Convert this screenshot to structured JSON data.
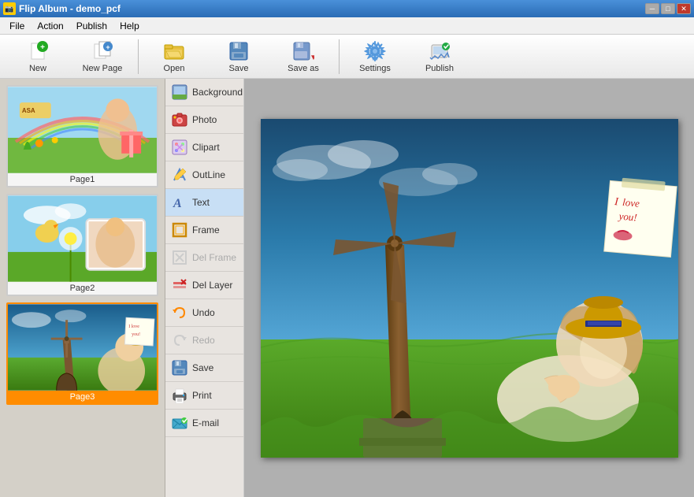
{
  "titlebar": {
    "title": "Flip Album - demo_pcf",
    "icon": "📷",
    "buttons": {
      "minimize": "─",
      "maximize": "□",
      "close": "✕"
    }
  },
  "menubar": {
    "items": [
      "File",
      "Action",
      "Publish",
      "Help"
    ]
  },
  "toolbar": {
    "buttons": [
      {
        "id": "new",
        "label": "New",
        "icon": "new"
      },
      {
        "id": "new-page",
        "label": "New Page",
        "icon": "newpage"
      },
      {
        "id": "open",
        "label": "Open",
        "icon": "open"
      },
      {
        "id": "save",
        "label": "Save",
        "icon": "save"
      },
      {
        "id": "save-as",
        "label": "Save as",
        "icon": "saveas"
      },
      {
        "id": "settings",
        "label": "Settings",
        "icon": "settings"
      },
      {
        "id": "publish",
        "label": "Publish",
        "icon": "publish"
      }
    ]
  },
  "pages": [
    {
      "id": "page1",
      "label": "Page1",
      "active": false
    },
    {
      "id": "page2",
      "label": "Page2",
      "active": false
    },
    {
      "id": "page3",
      "label": "Page3",
      "active": true
    }
  ],
  "tools": [
    {
      "id": "background",
      "label": "Background",
      "icon": "bg",
      "disabled": false
    },
    {
      "id": "photo",
      "label": "Photo",
      "icon": "photo",
      "disabled": false
    },
    {
      "id": "clipart",
      "label": "Clipart",
      "icon": "clipart",
      "disabled": false
    },
    {
      "id": "outline",
      "label": "OutLine",
      "icon": "outline",
      "disabled": false
    },
    {
      "id": "text",
      "label": "Text",
      "icon": "text",
      "active": true,
      "disabled": false
    },
    {
      "id": "frame",
      "label": "Frame",
      "icon": "frame",
      "disabled": false
    },
    {
      "id": "del-frame",
      "label": "Del Frame",
      "icon": "delframe",
      "disabled": true
    },
    {
      "id": "del-layer",
      "label": "Del Layer",
      "icon": "dellayer",
      "disabled": false
    },
    {
      "id": "undo",
      "label": "Undo",
      "icon": "undo",
      "disabled": false
    },
    {
      "id": "redo",
      "label": "Redo",
      "icon": "redo",
      "disabled": true
    },
    {
      "id": "save",
      "label": "Save",
      "icon": "save2",
      "disabled": false
    },
    {
      "id": "print",
      "label": "Print",
      "icon": "print",
      "disabled": false
    },
    {
      "id": "email",
      "label": "E-mail",
      "icon": "email",
      "disabled": false
    }
  ],
  "canvas": {
    "page3_note": "I love you!",
    "page3_note_line2": "you!"
  }
}
